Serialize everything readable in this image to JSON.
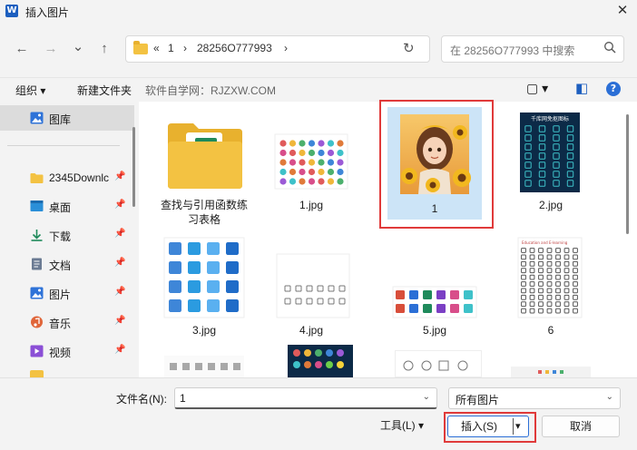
{
  "window": {
    "app_icon_letter": "W",
    "title": "插入图片",
    "close_glyph": "✕"
  },
  "nav": {
    "back_glyph": "←",
    "forward_glyph": "→",
    "recent_glyph": "⌄",
    "up_glyph": "↑",
    "breadcrumbs": [
      "«",
      "1",
      "›",
      "28256O777993",
      "›"
    ],
    "refresh_glyph": "↻",
    "search_placeholder": "在 28256O777993 中搜索"
  },
  "toolbar": {
    "organize": "组织 ▾",
    "new_folder": "新建文件夹",
    "watermark": "软件自学网：RJZXW.COM",
    "view_glyph": "▢ ▾",
    "pane_glyph": "◧",
    "help_glyph": "?"
  },
  "sidebar": {
    "items": [
      {
        "label": "图库",
        "icon": "gallery-icon",
        "selected": true
      },
      {
        "label": "2345Downlc",
        "icon": "folder-icon",
        "pinned": true
      },
      {
        "label": "桌面",
        "icon": "desktop-icon",
        "pinned": true
      },
      {
        "label": "下载",
        "icon": "download-icon",
        "pinned": true
      },
      {
        "label": "文档",
        "icon": "document-icon",
        "pinned": true
      },
      {
        "label": "图片",
        "icon": "pictures-icon",
        "pinned": true
      },
      {
        "label": "音乐",
        "icon": "music-icon",
        "pinned": true
      },
      {
        "label": "视频",
        "icon": "video-icon",
        "pinned": true
      }
    ],
    "pin_glyph": "📌"
  },
  "files": [
    {
      "name": "查找与引用函数练习表格",
      "type": "folder"
    },
    {
      "name": "1.jpg",
      "type": "image"
    },
    {
      "name": "1",
      "type": "image",
      "selected": true
    },
    {
      "name": "2.jpg",
      "type": "image"
    },
    {
      "name": "3.jpg",
      "type": "image"
    },
    {
      "name": "4.jpg",
      "type": "image"
    },
    {
      "name": "5.jpg",
      "type": "image"
    },
    {
      "name": "6",
      "type": "image"
    }
  ],
  "thumb_text": {
    "poster_title": "千库网免抠图标",
    "edu_title": "Education and E-learning"
  },
  "bottom": {
    "filename_label": "文件名(N):",
    "filename_value": "1",
    "filter_value": "所有图片",
    "tools_label": "工具(L)  ▾",
    "insert_label": "插入(S)",
    "insert_arrow": "▾",
    "cancel_label": "取消",
    "dropdown_glyph": "⌄"
  },
  "colors": {
    "accent": "#2b6fd6",
    "highlight_box": "#e03a3a",
    "selection": "#cce4f7",
    "folder": "#f3c242"
  }
}
